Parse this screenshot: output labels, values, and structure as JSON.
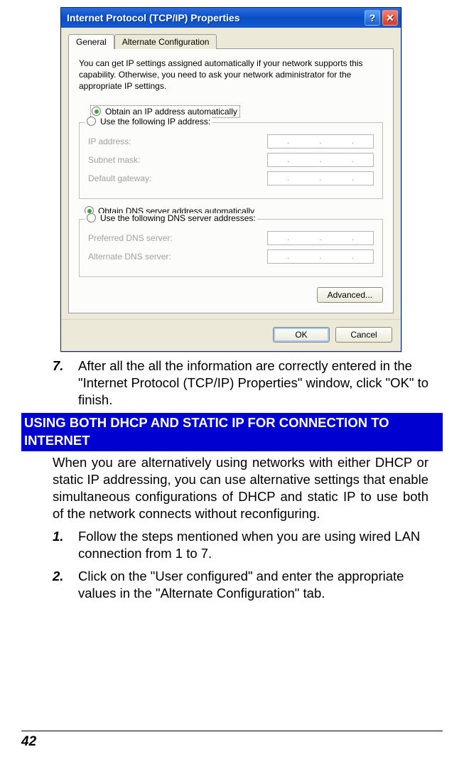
{
  "dialog": {
    "title": "Internet Protocol (TCP/IP) Properties",
    "helpBtn": "?",
    "closeBtn": "✕",
    "tabs": {
      "general": "General",
      "alternate": "Alternate Configuration"
    },
    "desc": "You can get IP settings assigned automatically if your network supports this capability. Otherwise, you need to ask your network administrator for the appropriate IP settings.",
    "radioObtainIP": "Obtain an IP address automatically",
    "radioUseIP": "Use the following IP address:",
    "ipAddress": "IP address:",
    "subnet": "Subnet mask:",
    "gateway": "Default gateway:",
    "radioObtainDNS": "Obtain DNS server address automatically",
    "radioUseDNS": "Use the following DNS server addresses:",
    "prefDNS": "Preferred DNS server:",
    "altDNS": "Alternate DNS server:",
    "advanced": "Advanced...",
    "ok": "OK",
    "cancel": "Cancel"
  },
  "doc": {
    "step7num": "7.",
    "step7": "After all the all the information are correctly entered in the \"Internet Protocol (TCP/IP) Properties\" window, click \"OK\" to finish.",
    "section": "USING BOTH DHCP AND STATIC IP FOR CONNECTION TO INTERNET",
    "para": "When you are alternatively using networks with either DHCP or static IP addressing, you can use alternative settings that enable simultaneous configurations of DHCP and static IP to use both of the network connects without reconfiguring.",
    "step1num": "1.",
    "step1": "Follow the steps mentioned when you are using wired LAN connection from 1 to 7.",
    "step2num": "2.",
    "step2": "Click on the \"User configured\" and enter the appropriate values in the \"Alternate Configuration\" tab.",
    "pageNum": "42"
  }
}
